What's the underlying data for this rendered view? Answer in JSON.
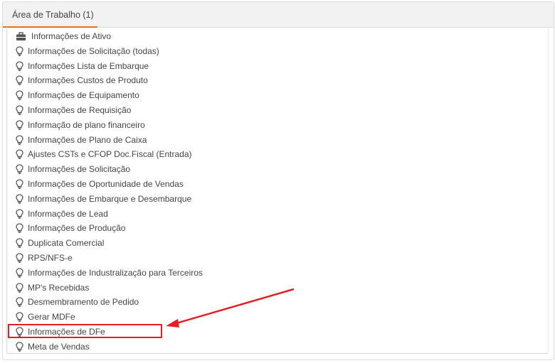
{
  "tab": {
    "label": "Área de Trabalho (1)"
  },
  "colors": {
    "accent": "#e8701a",
    "annotation": "#e31e24"
  },
  "items": [
    {
      "label": "Informações de Ativo",
      "icon": "briefcase-icon"
    },
    {
      "label": "Informações de Solicitação (todas)",
      "icon": "lightbulb-icon"
    },
    {
      "label": "Informações Lista de Embarque",
      "icon": "lightbulb-icon"
    },
    {
      "label": "Informações Custos de Produto",
      "icon": "lightbulb-icon"
    },
    {
      "label": "Informações de Equipamento",
      "icon": "lightbulb-icon"
    },
    {
      "label": "Informações de Requisição",
      "icon": "lightbulb-icon"
    },
    {
      "label": "Informação de plano financeiro",
      "icon": "lightbulb-icon"
    },
    {
      "label": "Informações de Plano de Caixa",
      "icon": "lightbulb-icon"
    },
    {
      "label": "Ajustes CSTs e CFOP Doc.Fiscal (Entrada)",
      "icon": "lightbulb-icon"
    },
    {
      "label": "Informações de Solicitação",
      "icon": "lightbulb-icon"
    },
    {
      "label": "Informações de Oportunidade de Vendas",
      "icon": "lightbulb-icon"
    },
    {
      "label": "Informações de Embarque e Desembarque",
      "icon": "lightbulb-icon"
    },
    {
      "label": "Informações de Lead",
      "icon": "lightbulb-icon"
    },
    {
      "label": "Informações de Produção",
      "icon": "lightbulb-icon"
    },
    {
      "label": "Duplicata Comercial",
      "icon": "lightbulb-icon"
    },
    {
      "label": "RPS/NFS-e",
      "icon": "lightbulb-icon"
    },
    {
      "label": "Informações de Industralização para Terceiros",
      "icon": "lightbulb-icon"
    },
    {
      "label": "MP's Recebidas",
      "icon": "lightbulb-icon"
    },
    {
      "label": "Desmembramento de Pedido",
      "icon": "lightbulb-icon"
    },
    {
      "label": "Gerar MDFe",
      "icon": "lightbulb-icon"
    },
    {
      "label": "Informações de DFe",
      "icon": "lightbulb-icon"
    },
    {
      "label": "Meta de Vendas",
      "icon": "lightbulb-icon"
    }
  ]
}
